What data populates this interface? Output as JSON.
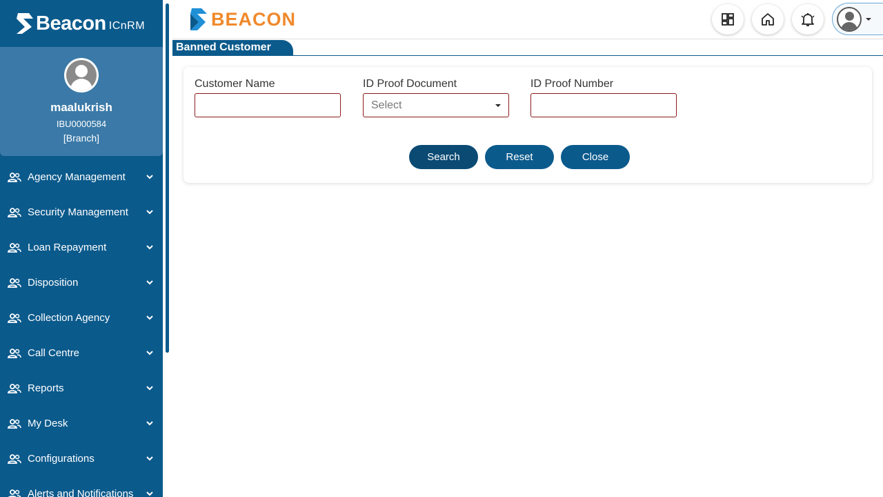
{
  "brand": {
    "name": "Beacon",
    "suffix": "ICnRM"
  },
  "profile": {
    "name": "maalukrish",
    "id": "IBU0000584",
    "role": "[Branch]"
  },
  "sidebar": {
    "items": [
      {
        "label": "Agency Management"
      },
      {
        "label": "Security Management"
      },
      {
        "label": "Loan Repayment"
      },
      {
        "label": "Disposition"
      },
      {
        "label": "Collection Agency"
      },
      {
        "label": "Call Centre"
      },
      {
        "label": "Reports"
      },
      {
        "label": "My Desk"
      },
      {
        "label": "Configurations"
      },
      {
        "label": "Alerts and Notifications"
      }
    ]
  },
  "header": {
    "logo_text": "BEACON"
  },
  "page": {
    "title": "Banned Customer"
  },
  "form": {
    "customer_name_label": "Customer Name",
    "customer_name_value": "",
    "id_proof_doc_label": "ID Proof Document",
    "id_proof_doc_value": "Select",
    "id_proof_number_label": "ID Proof Number",
    "id_proof_number_value": "",
    "search_label": "Search",
    "reset_label": "Reset",
    "close_label": "Close"
  },
  "colors": {
    "primary": "#0b5a8c",
    "accent": "#f0892b",
    "input_border": "#8b1a1a"
  }
}
